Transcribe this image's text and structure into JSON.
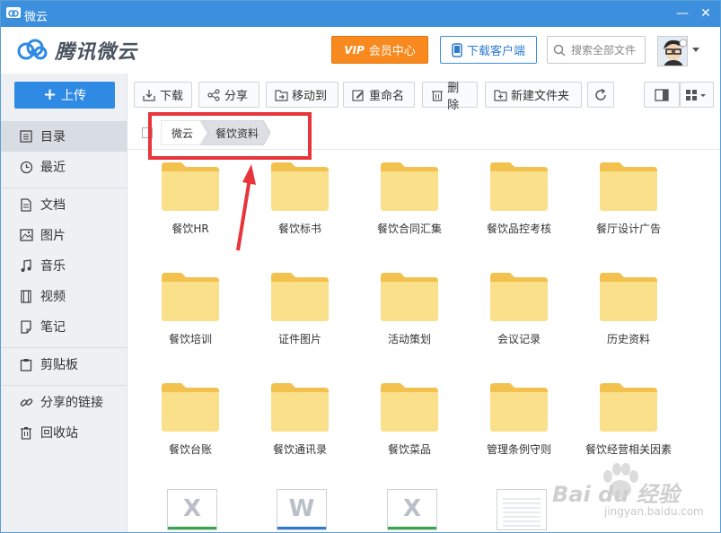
{
  "window": {
    "title": "微云",
    "minimize": "—",
    "close": "✕"
  },
  "header": {
    "logo_text": "腾讯微云",
    "vip_badge": "VIP",
    "vip_label": "会员中心",
    "download_client": "下载客户端",
    "search_placeholder": "搜索全部文件"
  },
  "sidebar": {
    "upload_label": "上传",
    "groups": [
      [
        {
          "label": "目录",
          "icon": "list-icon",
          "active": true
        },
        {
          "label": "最近",
          "icon": "clock-icon"
        }
      ],
      [
        {
          "label": "文档",
          "icon": "document-icon"
        },
        {
          "label": "图片",
          "icon": "image-icon"
        },
        {
          "label": "音乐",
          "icon": "music-icon"
        },
        {
          "label": "视频",
          "icon": "video-icon"
        },
        {
          "label": "笔记",
          "icon": "note-icon"
        }
      ],
      [
        {
          "label": "剪贴板",
          "icon": "clipboard-icon"
        }
      ],
      [
        {
          "label": "分享的链接",
          "icon": "link-icon"
        },
        {
          "label": "回收站",
          "icon": "trash-icon"
        }
      ]
    ]
  },
  "toolbar": {
    "download": "下载",
    "share": "分享",
    "move": "移动到",
    "rename": "重命名",
    "delete": "删除",
    "new_folder": "新建文件夹"
  },
  "breadcrumb": {
    "root": "微云",
    "current": "餐饮资料"
  },
  "folders": [
    "餐饮HR",
    "餐饮标书",
    "餐饮合同汇集",
    "餐饮品控考核",
    "餐厅设计广告",
    "餐饮培训",
    "证件图片",
    "活动策划",
    "会议记录",
    "历史资料",
    "餐饮台账",
    "餐饮通讯录",
    "餐饮菜品",
    "管理条例守则",
    "餐饮经营相关因素"
  ],
  "files": [
    {
      "type": "excel",
      "letter": "X",
      "color": "#3aa64c"
    },
    {
      "type": "word",
      "letter": "W",
      "color": "#2c7bd0"
    },
    {
      "type": "excel",
      "letter": "X",
      "color": "#3aa64c"
    },
    {
      "type": "text",
      "letter": "",
      "color": "#cfd3d8"
    }
  ],
  "watermark": {
    "brand": "Bai du 经验",
    "url": "jingyan.baidu.com"
  },
  "colors": {
    "titlebar": "#3c8fdd",
    "accent": "#2f8ae3",
    "vip": "#f7891e",
    "highlight": "#e8343a",
    "folder": "#f9d56e"
  }
}
